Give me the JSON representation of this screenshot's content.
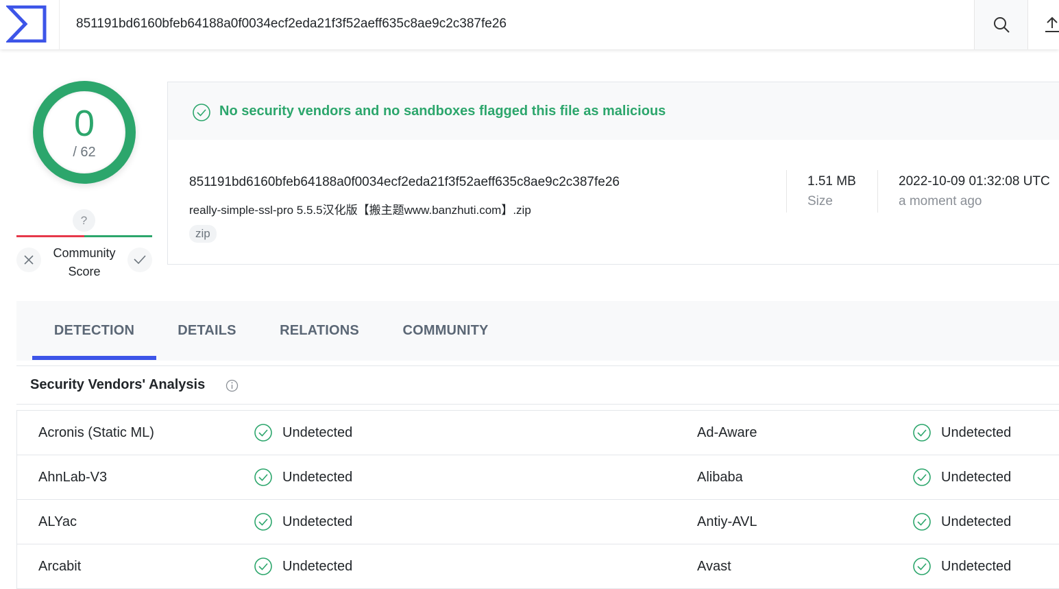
{
  "search": {
    "value": "851191bd6160bfeb64188a0f0034ecf2eda21f3f52aeff635c8ae9c2c387fe26",
    "search_icon": "search-icon",
    "upload_icon": "upload-icon"
  },
  "score": {
    "detected": "0",
    "total": "/ 62",
    "color": "#2ca66c"
  },
  "community": {
    "score_unknown": "?",
    "label_line1": "Community",
    "label_line2": "Score"
  },
  "summary": {
    "banner": "No security vendors and no sandboxes flagged this file as malicious",
    "hash": "851191bd6160bfeb64188a0f0034ecf2eda21f3f52aeff635c8ae9c2c387fe26",
    "filename": "really-simple-ssl-pro 5.5.5汉化版【搬主题www.banzhuti.com】.zip",
    "tag": "zip",
    "size_value": "1.51 MB",
    "size_label": "Size",
    "date_value": "2022-10-09 01:32:08 UTC",
    "date_label": "a moment ago"
  },
  "tabs": [
    {
      "label": "DETECTION",
      "active": true
    },
    {
      "label": "DETAILS",
      "active": false
    },
    {
      "label": "RELATIONS",
      "active": false
    },
    {
      "label": "COMMUNITY",
      "active": false
    }
  ],
  "analysis": {
    "title": "Security Vendors' Analysis",
    "rows": [
      {
        "left_vendor": "Acronis (Static ML)",
        "left_result": "Undetected",
        "right_vendor": "Ad-Aware",
        "right_result": "Undetected"
      },
      {
        "left_vendor": "AhnLab-V3",
        "left_result": "Undetected",
        "right_vendor": "Alibaba",
        "right_result": "Undetected"
      },
      {
        "left_vendor": "ALYac",
        "left_result": "Undetected",
        "right_vendor": "Antiy-AVL",
        "right_result": "Undetected"
      },
      {
        "left_vendor": "Arcabit",
        "left_result": "Undetected",
        "right_vendor": "Avast",
        "right_result": "Undetected"
      }
    ]
  },
  "colors": {
    "accent": "#3d55e8",
    "clean": "#2ca66c",
    "malicious": "#e6384a"
  }
}
